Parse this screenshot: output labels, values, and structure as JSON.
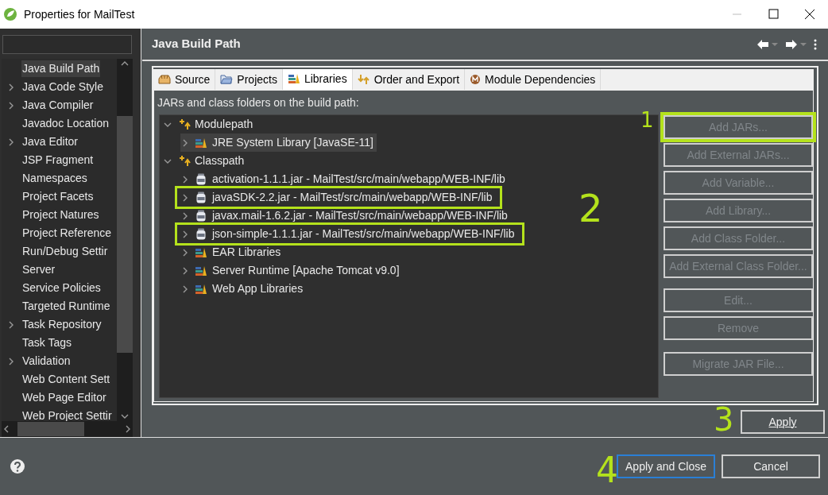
{
  "window": {
    "title": "Properties for MailTest"
  },
  "sidebar": {
    "items": [
      {
        "label": "Java Build Path",
        "expandable": false,
        "selected": true
      },
      {
        "label": "Java Code Style",
        "expandable": true,
        "selected": false
      },
      {
        "label": "Java Compiler",
        "expandable": true,
        "selected": false
      },
      {
        "label": "Javadoc Location",
        "expandable": false,
        "selected": false
      },
      {
        "label": "Java Editor",
        "expandable": true,
        "selected": false
      },
      {
        "label": "JSP Fragment",
        "expandable": false,
        "selected": false
      },
      {
        "label": "Namespaces",
        "expandable": false,
        "selected": false
      },
      {
        "label": "Project Facets",
        "expandable": false,
        "selected": false
      },
      {
        "label": "Project Natures",
        "expandable": false,
        "selected": false
      },
      {
        "label": "Project Reference",
        "expandable": false,
        "selected": false
      },
      {
        "label": "Run/Debug Settir",
        "expandable": false,
        "selected": false
      },
      {
        "label": "Server",
        "expandable": false,
        "selected": false
      },
      {
        "label": "Service Policies",
        "expandable": false,
        "selected": false
      },
      {
        "label": "Targeted Runtime",
        "expandable": false,
        "selected": false
      },
      {
        "label": "Task Repository",
        "expandable": true,
        "selected": false
      },
      {
        "label": "Task Tags",
        "expandable": false,
        "selected": false
      },
      {
        "label": "Validation",
        "expandable": true,
        "selected": false
      },
      {
        "label": "Web Content Sett",
        "expandable": false,
        "selected": false
      },
      {
        "label": "Web Page Editor",
        "expandable": false,
        "selected": false
      },
      {
        "label": "Web Project Settir",
        "expandable": false,
        "selected": false
      }
    ]
  },
  "page": {
    "title": "Java Build Path"
  },
  "tabs": [
    {
      "label": "Source",
      "kind": "source",
      "selected": false
    },
    {
      "label": "Projects",
      "kind": "projects",
      "selected": false
    },
    {
      "label": "Libraries",
      "kind": "libraries",
      "selected": true
    },
    {
      "label": "Order and Export",
      "kind": "order",
      "selected": false
    },
    {
      "label": "Module Dependencies",
      "kind": "module",
      "selected": false
    }
  ],
  "libraries": {
    "caption": "JARs and class folders on the build path:",
    "tree": [
      {
        "label": "Modulepath",
        "expanded": true,
        "children": [
          {
            "label": "JRE System Library [JavaSE-11]",
            "kind": "library",
            "selected": true,
            "highlighted": false
          }
        ]
      },
      {
        "label": "Classpath",
        "expanded": true,
        "children": [
          {
            "label": "activation-1.1.1.jar - MailTest/src/main/webapp/WEB-INF/lib",
            "kind": "jar",
            "selected": false,
            "highlighted": false
          },
          {
            "label": "javaSDK-2.2.jar - MailTest/src/main/webapp/WEB-INF/lib",
            "kind": "jar",
            "selected": false,
            "highlighted": true
          },
          {
            "label": "javax.mail-1.6.2.jar - MailTest/src/main/webapp/WEB-INF/lib",
            "kind": "jar",
            "selected": false,
            "highlighted": false
          },
          {
            "label": "json-simple-1.1.1.jar - MailTest/src/main/webapp/WEB-INF/lib",
            "kind": "jar",
            "selected": false,
            "highlighted": true
          },
          {
            "label": "EAR Libraries",
            "kind": "library",
            "selected": false,
            "highlighted": false
          },
          {
            "label": "Server Runtime [Apache Tomcat v9.0]",
            "kind": "library",
            "selected": false,
            "highlighted": false
          },
          {
            "label": "Web App Libraries",
            "kind": "library",
            "selected": false,
            "highlighted": false
          }
        ]
      }
    ],
    "buttons": [
      {
        "label": "Add JARs...",
        "disabled": true,
        "highlighted": true,
        "gap_before": false
      },
      {
        "label": "Add External JARs...",
        "disabled": true,
        "highlighted": false,
        "gap_before": false
      },
      {
        "label": "Add Variable...",
        "disabled": true,
        "highlighted": false,
        "gap_before": false
      },
      {
        "label": "Add Library...",
        "disabled": true,
        "highlighted": false,
        "gap_before": false
      },
      {
        "label": "Add Class Folder...",
        "disabled": true,
        "highlighted": false,
        "gap_before": false
      },
      {
        "label": "Add External Class Folder...",
        "disabled": true,
        "highlighted": false,
        "gap_before": false
      },
      {
        "label": "Edit...",
        "disabled": true,
        "highlighted": false,
        "gap_before": true
      },
      {
        "label": "Remove",
        "disabled": true,
        "highlighted": false,
        "gap_before": false
      },
      {
        "label": "Migrate JAR File...",
        "disabled": true,
        "highlighted": false,
        "gap_before": true
      }
    ]
  },
  "apply_button": {
    "label": "Apply"
  },
  "footer": {
    "buttons": [
      {
        "label": "Apply and Close",
        "default": true
      },
      {
        "label": "Cancel",
        "default": false
      }
    ]
  },
  "annotations": [
    "1",
    "2",
    "3",
    "4"
  ]
}
